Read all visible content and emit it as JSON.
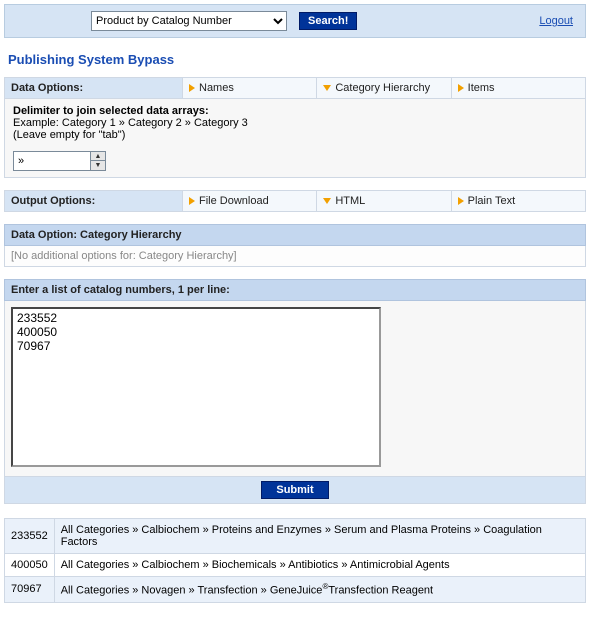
{
  "topbar": {
    "dropdown_value": "Product by Catalog Number",
    "search_label": "Search!",
    "logout_label": "Logout"
  },
  "page_title": "Publishing System Bypass",
  "data_options": {
    "label": "Data Options:",
    "items": [
      {
        "label": "Names",
        "active": false
      },
      {
        "label": "Category Hierarchy",
        "active": true
      },
      {
        "label": "Items",
        "active": false
      }
    ]
  },
  "delimiter": {
    "title": "Delimiter to join selected data arrays:",
    "example": "Example: Category 1 » Category 2 » Category 3",
    "hint": "(Leave empty for \"tab\")",
    "value": "»"
  },
  "output_options": {
    "label": "Output Options:",
    "items": [
      {
        "label": "File Download",
        "active": false
      },
      {
        "label": "HTML",
        "active": true
      },
      {
        "label": "Plain Text",
        "active": false
      }
    ]
  },
  "data_option_detail": {
    "header": "Data Option: Category Hierarchy",
    "body": "[No additional options for: Category Hierarchy]"
  },
  "catalog_input": {
    "header": "Enter a list of catalog numbers, 1 per line:",
    "value": "233552\n400050\n70967"
  },
  "submit_label": "Submit",
  "results": [
    {
      "cat": "233552",
      "path": "All Categories » Calbiochem » Proteins and Enzymes » Serum and Plasma Proteins » Coagulation Factors"
    },
    {
      "cat": "400050",
      "path": "All Categories » Calbiochem » Biochemicals » Antibiotics » Antimicrobial Agents"
    },
    {
      "cat": "70967",
      "path": "All Categories » Novagen » Transfection » GeneJuice®Transfection Reagent"
    }
  ]
}
